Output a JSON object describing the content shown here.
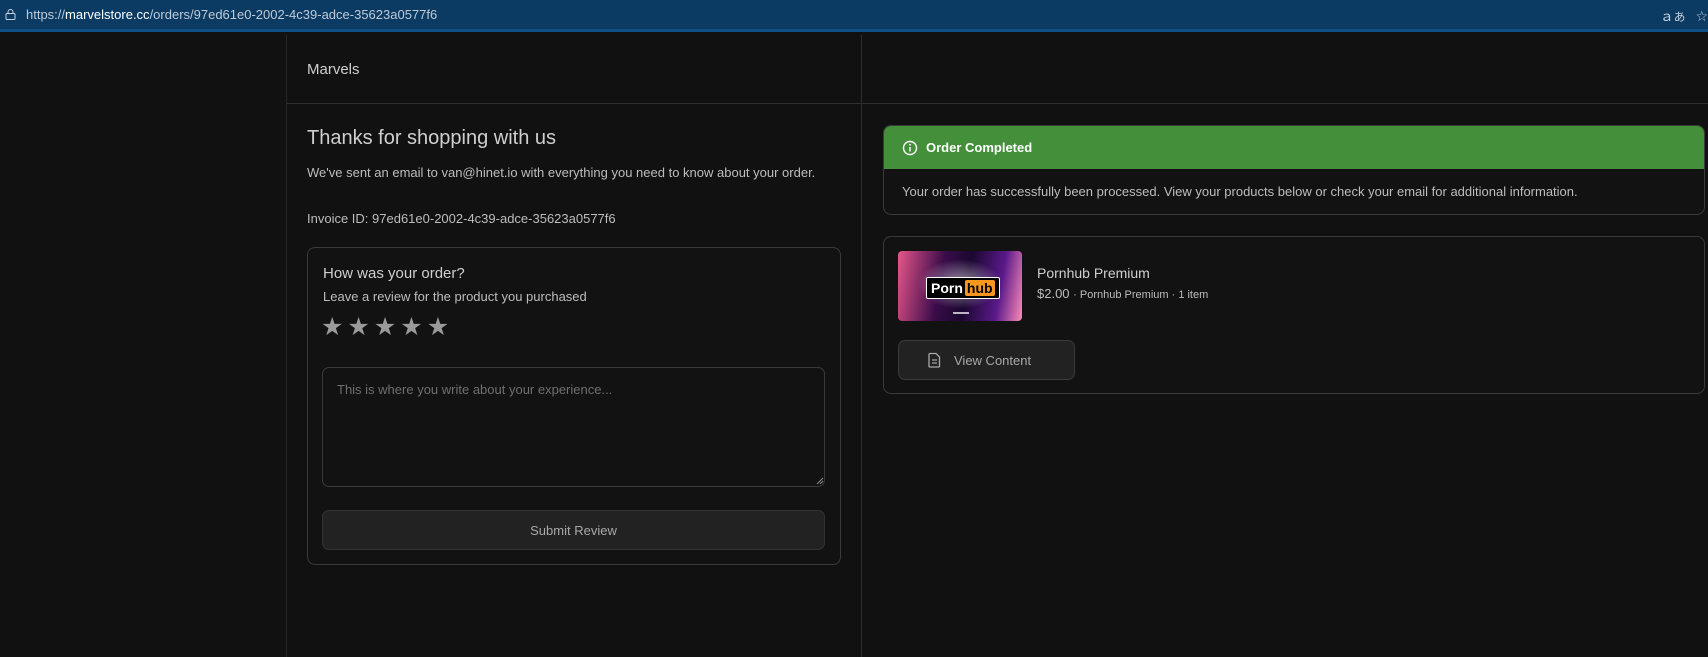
{
  "browser": {
    "url_scheme": "https://",
    "url_host": "marvelstore.cc",
    "url_path": "/orders/97ed61e0-2002-4c39-adce-35623a0577f6",
    "icons": [
      "lock-icon",
      "translate-icon",
      "bookmark-star-icon"
    ]
  },
  "header": {
    "brand": "Marvels"
  },
  "confirmation": {
    "title": "Thanks for shopping with us",
    "message": "We've sent an email to van@hinet.io with everything you need to know about your order.",
    "invoice": "Invoice ID: 97ed61e0-2002-4c39-adce-35623a0577f6"
  },
  "review": {
    "question": "How was your order?",
    "subtitle": "Leave a review for the product you purchased",
    "rating": 0,
    "rating_max": 5,
    "textarea_placeholder": "This is where you write about your experience...",
    "submit_label": "Submit Review"
  },
  "status": {
    "title": "Order Completed",
    "message": "Your order has successfully been processed. View your products below or check your email for additional information.",
    "color": "#44903a"
  },
  "product": {
    "name": "Pornhub Premium",
    "price": "$2.00",
    "meta": "· Pornhub Premium · 1 item",
    "thumb_logo_left": "Porn",
    "thumb_logo_right": "hub",
    "view_label": "View Content"
  }
}
